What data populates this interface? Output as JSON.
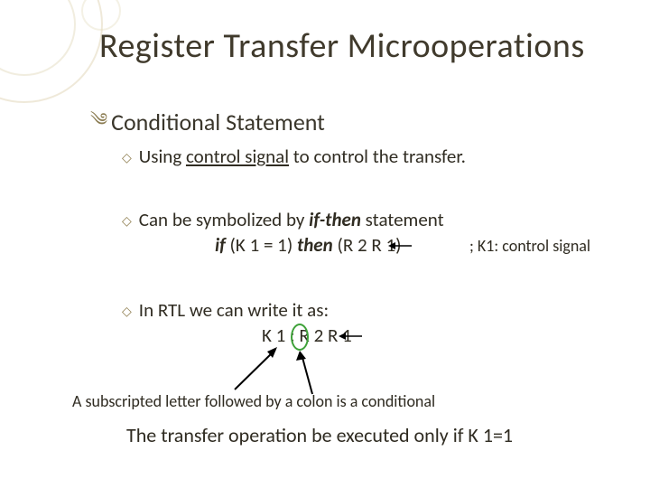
{
  "title": "Register Transfer Microoperations",
  "subtitle": "Conditional Statement",
  "bullets": {
    "b1_pre": "Using ",
    "b1_u": "control signal",
    "b1_post": " to control the transfer.",
    "b2_pre": "Can be symbolized by ",
    "b2_bi": "if-then",
    "b2_post": " statement",
    "b2_code_if": "if",
    "b2_code_mid": " (K 1 = 1) ",
    "b2_code_then": "then",
    "b2_code_paren": " (R 2     R 1)",
    "b2_comment": " ; K1: control signal",
    "b3": "In RTL we can write it as:",
    "b3_code": "K 1 : R 2     R 1"
  },
  "foot1": "A subscripted letter followed by a colon is a conditional",
  "foot2": "The transfer operation be executed only if K 1=1"
}
